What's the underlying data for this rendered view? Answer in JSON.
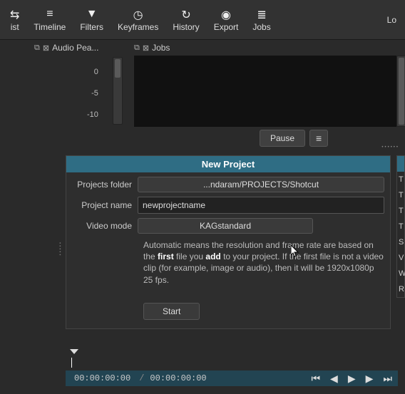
{
  "toolbar": {
    "items": [
      {
        "icon": "⇆",
        "label": "ist"
      },
      {
        "icon": "≡",
        "label": "Timeline"
      },
      {
        "icon": "▼",
        "label": "Filters"
      },
      {
        "icon": "◷",
        "label": "Keyframes"
      },
      {
        "icon": "↻",
        "label": "History"
      },
      {
        "icon": "◉",
        "label": "Export"
      },
      {
        "icon": "≣",
        "label": "Jobs"
      }
    ],
    "right_label": "Lo"
  },
  "peak": {
    "title": "Audio Pea...",
    "ticks": [
      "0",
      "-5",
      "-10"
    ]
  },
  "jobs": {
    "title": "Jobs",
    "pause_label": "Pause",
    "menu_icon": "≡"
  },
  "newproject": {
    "header": "New Project",
    "folder_label": "Projects folder",
    "folder_value": "...ndaram/PROJECTS/Shotcut",
    "name_label": "Project name",
    "name_value": "newprojectname",
    "mode_label": "Video mode",
    "mode_value": "KAGstandard",
    "help_pre": "Automatic means the resolution and frame rate are based on the ",
    "help_b1": "first",
    "help_mid": " file you ",
    "help_b2": "add",
    "help_post": " to your project. If the first file is not a video clip (for example, image or audio), then it will be 1920x1080p 25 fps.",
    "start_label": "Start"
  },
  "right_letters": [
    "T",
    "T",
    "T",
    "T",
    "S",
    "V",
    "W",
    "R"
  ],
  "timeline": {
    "tc1": "00:00:00:00",
    "tc2": "00:00:00:00"
  }
}
